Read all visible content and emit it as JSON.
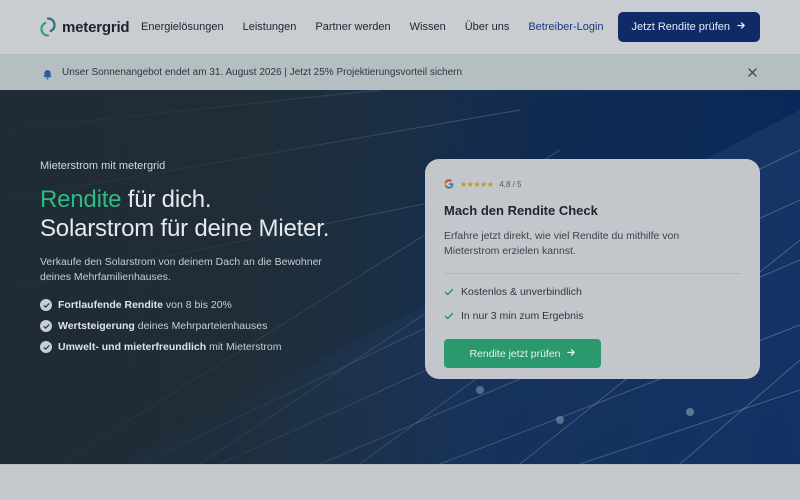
{
  "brand": {
    "name": "metergrid"
  },
  "nav": {
    "items": [
      {
        "label": "Energielösungen"
      },
      {
        "label": "Leistungen"
      },
      {
        "label": "Partner werden"
      },
      {
        "label": "Wissen"
      },
      {
        "label": "Über uns"
      }
    ],
    "login_label": "Betreiber-Login",
    "cta_label": "Jetzt Rendite prüfen"
  },
  "announcement": {
    "text": "Unser Sonnenangebot endet am 31. August 2026 | Jetzt 25% Projektierungsvorteil sichern"
  },
  "hero": {
    "eyebrow": "Mieterstrom mit metergrid",
    "headline_accent": "Rendite",
    "headline_rest_1": " für dich.",
    "headline_line_2": "Solarstrom für deine Mieter.",
    "sub": "Verkaufe den Solarstrom von deinem Dach an die Bewohner deines Mehrfamilienhauses.",
    "bullets": [
      {
        "bold": "Fortlaufende Rendite",
        "rest": " von 8 bis 20%"
      },
      {
        "bold": "Wertsteigerung",
        "rest": " deines Mehrparteienhauses"
      },
      {
        "bold": "Umwelt- und mieterfreundlich",
        "rest": " mit Mieterstrom"
      }
    ]
  },
  "card": {
    "stars": "★★★★★",
    "rating": "4,8 / 5",
    "title": "Mach den Rendite Check",
    "text": "Erfahre jetzt direkt, wie viel Rendite du mithilfe von Mieterstrom erzielen kannst.",
    "items": [
      {
        "label": "Kostenlos & unverbindlich"
      },
      {
        "label": "In nur 3 min zum Ergebnis"
      }
    ],
    "button_label": "Rendite jetzt prüfen"
  },
  "colors": {
    "accent_green": "#2dbb83",
    "button_green": "#2a9a6e",
    "navy": "#0f2a66"
  }
}
